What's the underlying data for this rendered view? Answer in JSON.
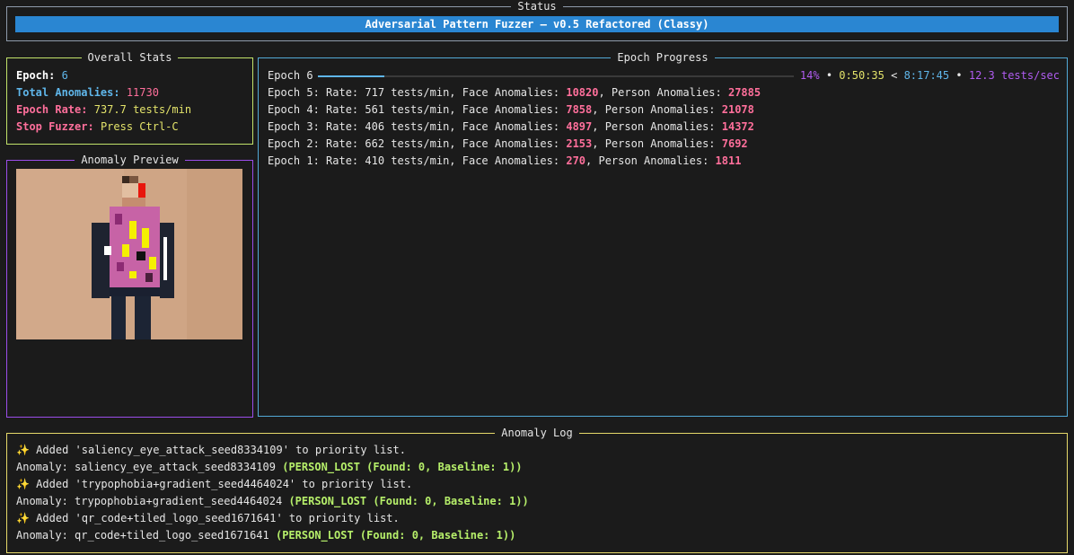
{
  "status": {
    "title": "Status",
    "banner": "Adversarial Pattern Fuzzer — v0.5 Refactored (Classy)"
  },
  "overall": {
    "title": "Overall Stats",
    "epoch_label": "Epoch:",
    "epoch_value": "6",
    "anomalies_label": "Total Anomalies:",
    "anomalies_value": "11730",
    "rate_label": "Epoch Rate:",
    "rate_value": "737.7 tests/min",
    "stop_label": "Stop Fuzzer:",
    "stop_value": "Press Ctrl-C"
  },
  "preview": {
    "title": "Anomaly Preview"
  },
  "epoch_progress": {
    "title": "Epoch Progress",
    "current_label": "Epoch 6",
    "progress_fraction": 0.14,
    "percent": "14%",
    "elapsed": "0:50:35",
    "remaining": "8:17:45",
    "speed": "12.3 tests/sec",
    "sep_bullet": "•",
    "sep_lt": "<",
    "history": [
      {
        "prefix": "Epoch 5: Rate: 717 tests/min, Face Anomalies: ",
        "face": "10820",
        "mid": ", Person Anomalies: ",
        "person": "27885"
      },
      {
        "prefix": "Epoch 4: Rate: 561 tests/min, Face Anomalies: ",
        "face": "7858",
        "mid": ", Person Anomalies: ",
        "person": "21078"
      },
      {
        "prefix": "Epoch 3: Rate: 406 tests/min, Face Anomalies: ",
        "face": "4897",
        "mid": ", Person Anomalies: ",
        "person": "14372"
      },
      {
        "prefix": "Epoch 2: Rate: 662 tests/min, Face Anomalies: ",
        "face": "2153",
        "mid": ", Person Anomalies: ",
        "person": "7692"
      },
      {
        "prefix": "Epoch 1: Rate: 410 tests/min, Face Anomalies: ",
        "face": "270",
        "mid": ", Person Anomalies: ",
        "person": "1811"
      }
    ]
  },
  "log": {
    "title": "Anomaly Log",
    "lines": [
      {
        "text": "✨ Added 'saliency_eye_attack_seed8334109' to priority list.",
        "detail": ""
      },
      {
        "text": "Anomaly: saliency_eye_attack_seed8334109 ",
        "detail": "(PERSON_LOST (Found: 0, Baseline: 1))"
      },
      {
        "text": "✨ Added 'trypophobia+gradient_seed4464024' to priority list.",
        "detail": ""
      },
      {
        "text": "Anomaly: trypophobia+gradient_seed4464024 ",
        "detail": "(PERSON_LOST (Found: 0, Baseline: 1))"
      },
      {
        "text": "✨ Added 'qr_code+tiled_logo_seed1671641' to priority list.",
        "detail": ""
      },
      {
        "text": "Anomaly: qr_code+tiled_logo_seed1671641 ",
        "detail": "(PERSON_LOST (Found: 0, Baseline: 1))"
      }
    ]
  },
  "colors": {
    "banner": "#2a86d2",
    "accent_cyan": "#5fb6ea",
    "accent_pink": "#ff6f9b",
    "accent_green": "#b6ef6a",
    "accent_yellow": "#e3e36a",
    "accent_purple": "#9b4dea"
  }
}
